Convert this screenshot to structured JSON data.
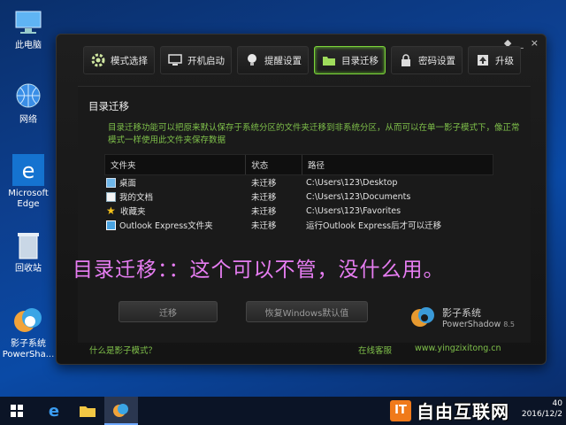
{
  "desktop": {
    "icons": [
      {
        "label": "此电脑",
        "icon": "computer-icon"
      },
      {
        "label": "网络",
        "icon": "network-icon"
      },
      {
        "label": "Microsoft Edge",
        "icon": "edge-icon"
      },
      {
        "label": "回收站",
        "icon": "recycle-bin-icon"
      },
      {
        "label": "影子系统 PowerSha...",
        "icon": "shadow-defender-icon"
      }
    ]
  },
  "window": {
    "controls": [
      "◆",
      "_",
      "×"
    ],
    "tabs": [
      {
        "label": "模式选择",
        "icon": "gear-icon"
      },
      {
        "label": "开机启动",
        "icon": "monitor-icon"
      },
      {
        "label": "提醒设置",
        "icon": "bulb-icon"
      },
      {
        "label": "目录迁移",
        "icon": "folder-icon",
        "active": true
      },
      {
        "label": "密码设置",
        "icon": "lock-icon"
      },
      {
        "label": "升级",
        "icon": "upgrade-icon"
      }
    ],
    "panel": {
      "title": "目录迁移",
      "description": "目录迁移功能可以把原来默认保存于系统分区的文件夹迁移到非系统分区，从而可以在单一影子模式下，像正常模式一样使用此文件夹保存数据",
      "table": {
        "headers": [
          "文件夹",
          "状态",
          "路径"
        ],
        "rows": [
          {
            "folder": "桌面",
            "status": "未迁移",
            "path": "C:\\Users\\123\\Desktop",
            "icon": "desktop-folder-icon"
          },
          {
            "folder": "我的文档",
            "status": "未迁移",
            "path": "C:\\Users\\123\\Documents",
            "icon": "documents-folder-icon"
          },
          {
            "folder": "收藏夹",
            "status": "未迁移",
            "path": "C:\\Users\\123\\Favorites",
            "icon": "favorites-star-icon"
          },
          {
            "folder": "Outlook Express文件夹",
            "status": "未迁移",
            "path": "运行Outlook Express后才可以迁移",
            "icon": "outlook-icon"
          }
        ]
      },
      "buttons": {
        "migrate": "迁移",
        "restore": "恢复Windows默认值"
      },
      "brand": {
        "name": "影子系统",
        "product": "PowerShadow",
        "version": "8.5"
      }
    },
    "footer": {
      "what_is": "什么是影子模式？",
      "online_service": "在线客服",
      "website": "www.yingzixitong.cn"
    }
  },
  "overlay_text": "目录迁移：：这个可以不管，没什么用。",
  "taskbar": {
    "clock_time": "40",
    "clock_date": "2016/12/2"
  },
  "watermark": {
    "logo": "IT",
    "text": "自由互联网"
  },
  "colors": {
    "accent_green": "#7bd43a",
    "annotation_pink": "#e77df2",
    "brand_orange": "#f07a1a"
  }
}
